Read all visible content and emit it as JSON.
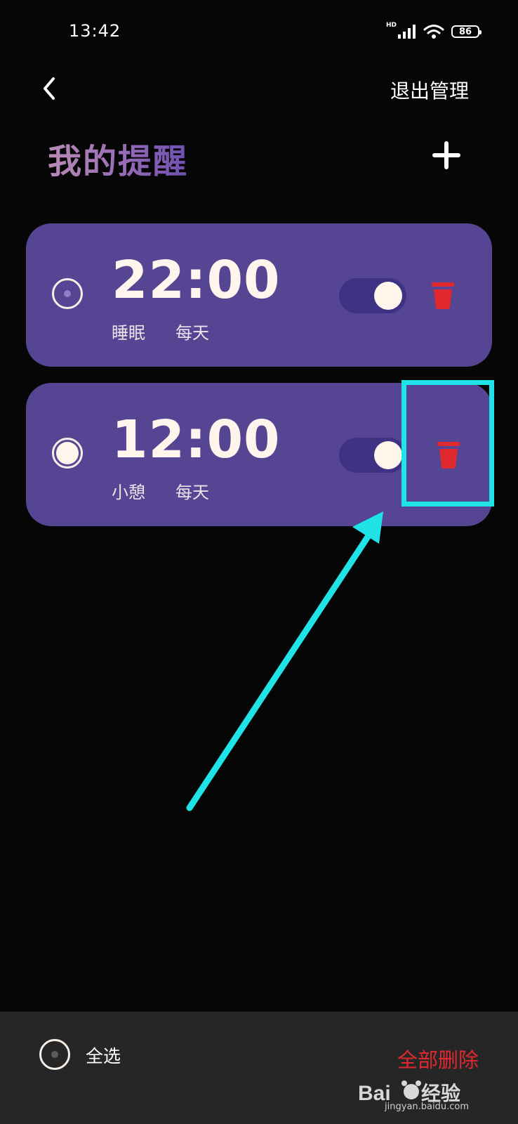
{
  "status_bar": {
    "time": "13:42",
    "network": "HD",
    "battery": "86"
  },
  "header": {
    "exit_manage_label": "退出管理"
  },
  "page_title": "我的提醒",
  "reminders": [
    {
      "time": "22:00",
      "name": "睡眠",
      "repeat": "每天",
      "enabled": true,
      "selected": false
    },
    {
      "time": "12:00",
      "name": "小憩",
      "repeat": "每天",
      "enabled": true,
      "selected": true
    }
  ],
  "footer": {
    "select_all_label": "全选",
    "delete_all_label": "全部删除"
  },
  "watermark": {
    "brand": "Baidu经验",
    "url": "jingyan.baidu.com"
  },
  "colors": {
    "background": "#070607",
    "card": "#554593",
    "toggle_track": "#3d3283",
    "delete_red": "#e0292e",
    "annotation_cyan": "#1fe3e6",
    "bottom_bar": "#262626"
  },
  "icons": [
    "back-arrow-icon",
    "plus-icon",
    "trash-icon",
    "wifi-icon",
    "signal-icon",
    "battery-icon"
  ]
}
